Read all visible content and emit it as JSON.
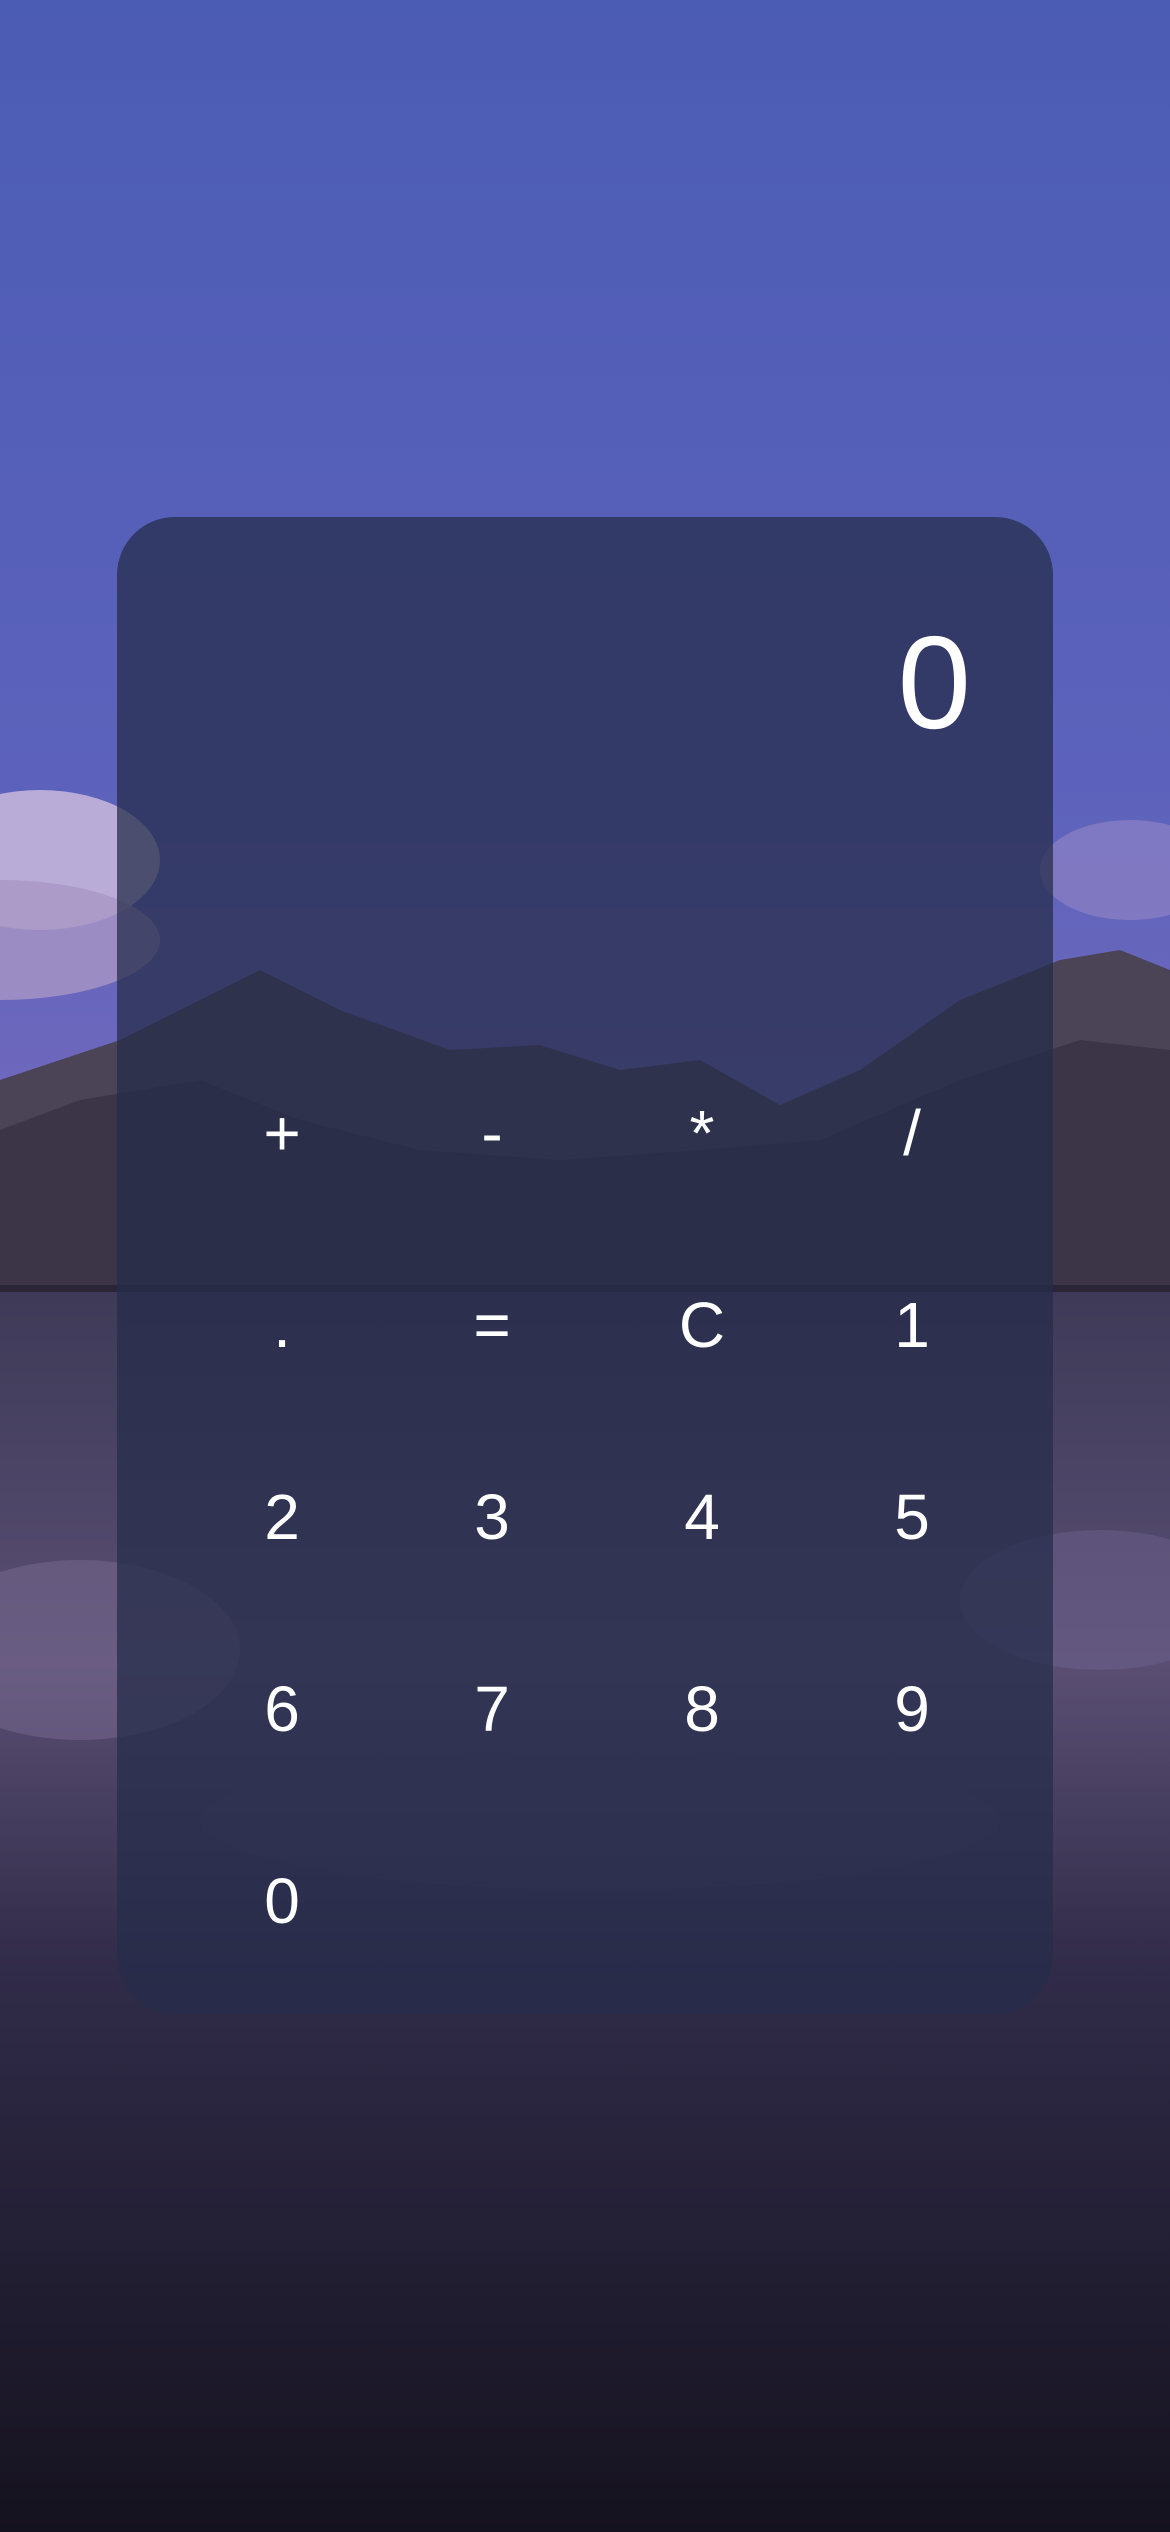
{
  "display": {
    "value": "0"
  },
  "keypad": {
    "keys": [
      "+",
      "-",
      "*",
      "/",
      ".",
      "=",
      "C",
      "1",
      "2",
      "3",
      "4",
      "5",
      "6",
      "7",
      "8",
      "9",
      "0"
    ]
  },
  "colors": {
    "sky_top": "#4e5db6",
    "sky_bottom": "#6b63b5",
    "panel": "#262c4a",
    "text": "#ffffff"
  }
}
